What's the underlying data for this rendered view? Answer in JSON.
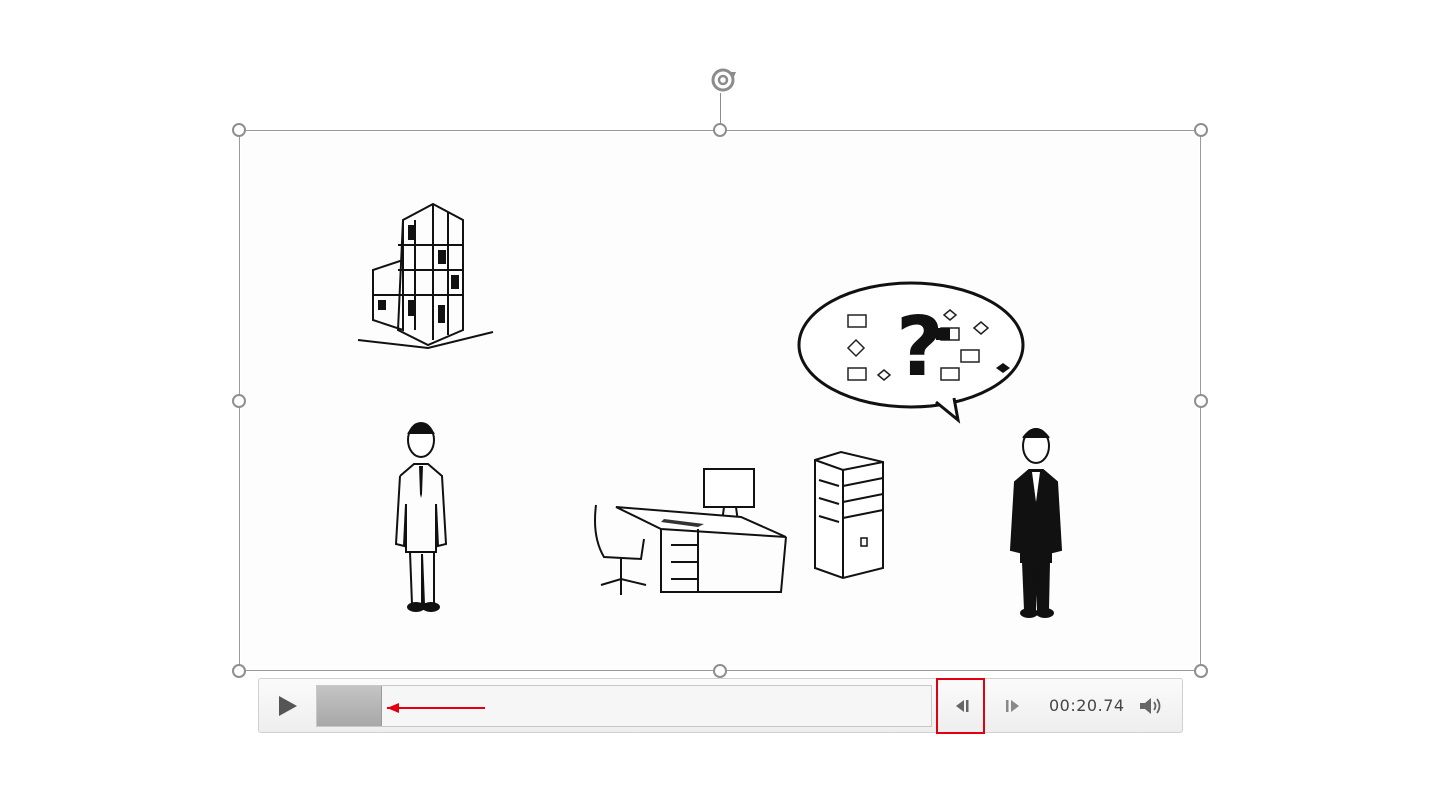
{
  "player": {
    "time_display": "00:20.74",
    "progress_fraction": 0.105
  },
  "colors": {
    "frame": "#9a9a9a",
    "highlight": "#e1000f",
    "arrow": "#e1000f",
    "progress_fill": "#b0b0b0"
  },
  "icons": {
    "play": "play-icon",
    "step_back": "step-back-icon",
    "step_forward": "step-forward-icon",
    "volume": "volume-icon",
    "rotate": "rotate-icon"
  }
}
